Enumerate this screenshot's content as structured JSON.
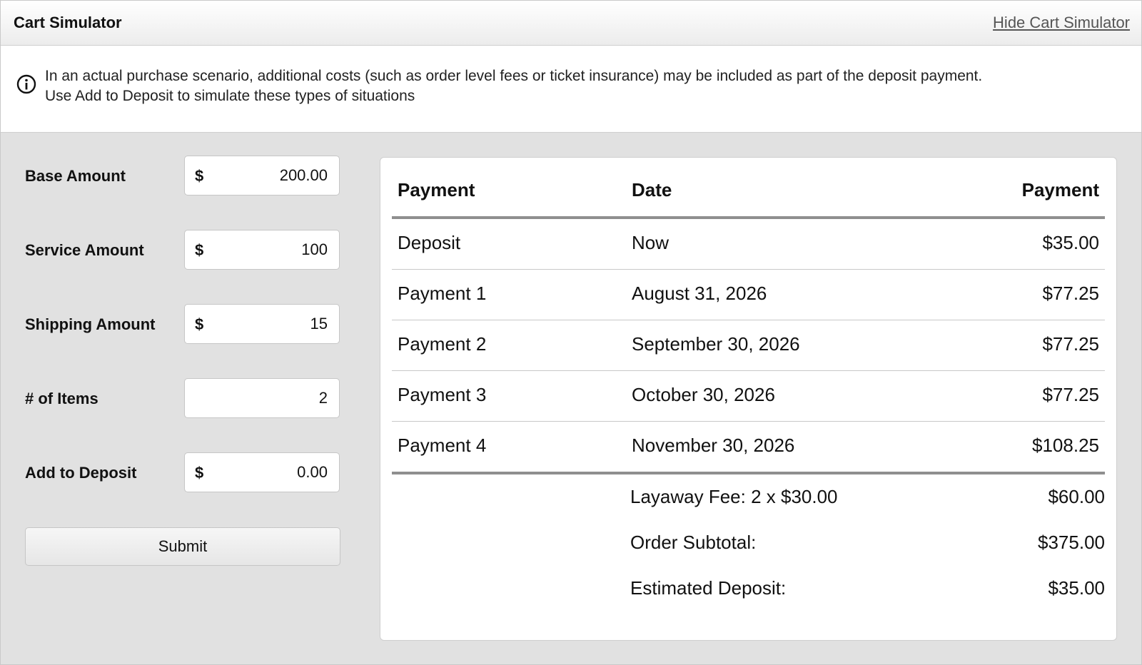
{
  "header": {
    "title": "Cart Simulator",
    "hide_link": "Hide Cart Simulator"
  },
  "notice": {
    "line1": "In an actual purchase scenario, additional costs (such as order level fees or ticket insurance) may be included as part of the deposit payment.",
    "line2": "Use Add to Deposit to simulate these types of situations"
  },
  "form": {
    "base_amount": {
      "label": "Base Amount",
      "currency": "$",
      "value": "200.00"
    },
    "service_amount": {
      "label": "Service Amount",
      "currency": "$",
      "value": "100"
    },
    "shipping_amount": {
      "label": "Shipping Amount",
      "currency": "$",
      "value": "15"
    },
    "items": {
      "label": "# of Items",
      "value": "2"
    },
    "add_to_deposit": {
      "label": "Add to Deposit",
      "currency": "$",
      "value": "0.00"
    },
    "submit_label": "Submit"
  },
  "schedule": {
    "headers": [
      "Payment",
      "Date",
      "Payment"
    ],
    "rows": [
      {
        "name": "Deposit",
        "date": "Now",
        "amount": "$35.00"
      },
      {
        "name": "Payment 1",
        "date": "August 31, 2026",
        "amount": "$77.25"
      },
      {
        "name": "Payment 2",
        "date": "September 30, 2026",
        "amount": "$77.25"
      },
      {
        "name": "Payment 3",
        "date": "October 30, 2026",
        "amount": "$77.25"
      },
      {
        "name": "Payment 4",
        "date": "November 30, 2026",
        "amount": "$108.25"
      }
    ]
  },
  "summary": {
    "layaway_fee_label": "Layaway Fee: 2 x $30.00",
    "layaway_fee_value": "$60.00",
    "subtotal_label": "Order Subtotal:",
    "subtotal_value": "$375.00",
    "deposit_label": "Estimated Deposit:",
    "deposit_value": "$35.00"
  }
}
